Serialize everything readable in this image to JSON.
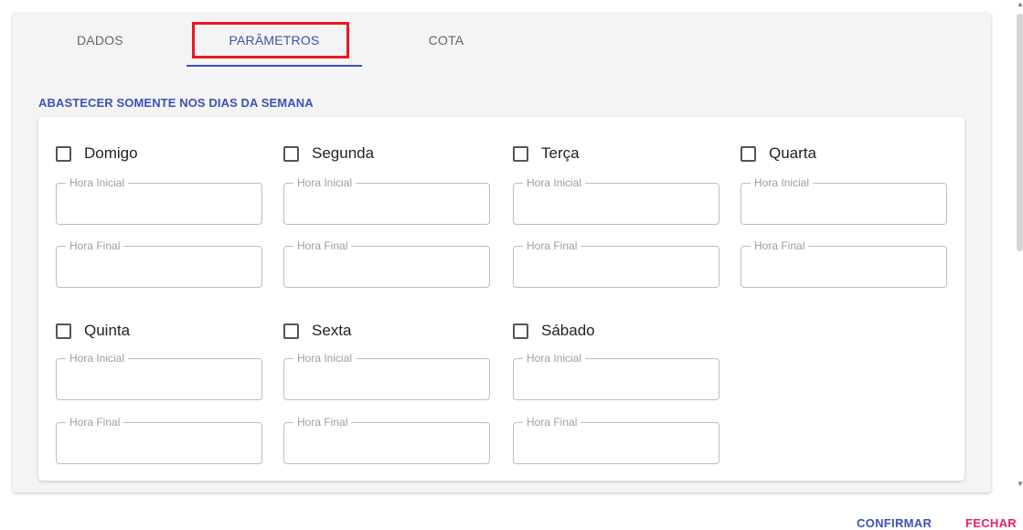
{
  "tabs": {
    "dados": "DADOS",
    "parametros": "PARÂMETROS",
    "cota": "COTA"
  },
  "section_title": "ABASTECER SOMENTE NOS DIAS DA SEMANA",
  "field_labels": {
    "start": "Hora Inicial",
    "end": "Hora Final"
  },
  "days": {
    "d0": "Domigo",
    "d1": "Segunda",
    "d2": "Terça",
    "d3": "Quarta",
    "d4": "Quinta",
    "d5": "Sexta",
    "d6": "Sábado"
  },
  "actions": {
    "confirm": "CONFIRMAR",
    "close": "FECHAR"
  },
  "colors": {
    "accent": "#3f51b5",
    "close": "#e91e63",
    "highlight": "#e8191e"
  }
}
